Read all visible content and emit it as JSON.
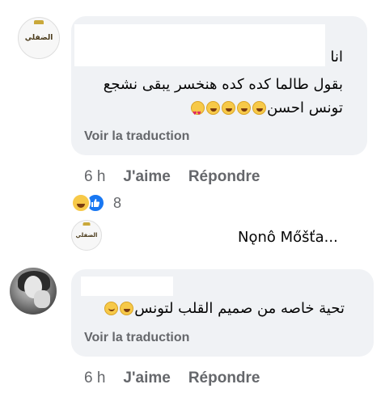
{
  "comment1": {
    "avatar_text": "الضفلي",
    "line1": "انا",
    "line2": "بقول طالما كده كده هنخسر يبقى نشجع",
    "line3": "تونس احسن",
    "see_translation": "Voir la traduction",
    "time": "6 h",
    "like": "J'aime",
    "reply": "Répondre",
    "reaction_count": "8"
  },
  "reply_preview": {
    "avatar_text": "الضفلي",
    "name": "Nǫnô Mőšťa..."
  },
  "comment2": {
    "text": "تحية خاصه من صميم القلب لتونس",
    "see_translation": "Voir la traduction",
    "time": "6 h",
    "like": "J'aime",
    "reply": "Répondre"
  },
  "icons": {
    "emoji_love": "heart-eyes-emoji",
    "emoji_laugh": "grinning-emoji",
    "emoji_smile": "smiling-emoji",
    "reaction_haha": "haha-reaction-icon",
    "reaction_like": "like-reaction-icon"
  },
  "colors": {
    "bubble": "#f0f2f5",
    "secondary_text": "#65676b",
    "primary_text": "#050505",
    "like_blue": "#1877f2"
  }
}
